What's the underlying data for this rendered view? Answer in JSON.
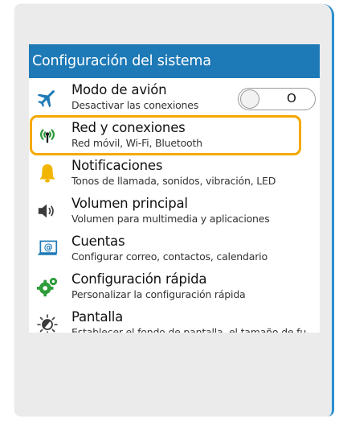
{
  "header": {
    "title": "Configuración del sistema"
  },
  "colors": {
    "titlebar": "#1e7ab7",
    "highlight": "#f5a800",
    "accent_blue": "#1e7ab7"
  },
  "settings": [
    {
      "icon": "airplane-icon",
      "title": "Modo de avión",
      "subtitle": "Desactivar las conexiones",
      "toggle": {
        "state": "O"
      }
    },
    {
      "icon": "wireless-icon",
      "title": "Red y conexiones",
      "subtitle": "Red móvil, Wi-Fi, Bluetooth",
      "highlighted": true
    },
    {
      "icon": "bell-icon",
      "title": "Notificaciones",
      "subtitle": "Tonos de llamada, sonidos, vibración, LED"
    },
    {
      "icon": "speaker-icon",
      "title": "Volumen principal",
      "subtitle": "Volumen para multimedia y aplicaciones"
    },
    {
      "icon": "accounts-icon",
      "title": "Cuentas",
      "subtitle": "Configurar correo, contactos, calendario"
    },
    {
      "icon": "quick-settings-icon",
      "title": "Configuración rápida",
      "subtitle": "Personalizar la configuración rápida"
    },
    {
      "icon": "display-icon",
      "title": "Pantalla",
      "subtitle": "Establecer el fondo de pantalla, el tamaño de fu"
    }
  ]
}
